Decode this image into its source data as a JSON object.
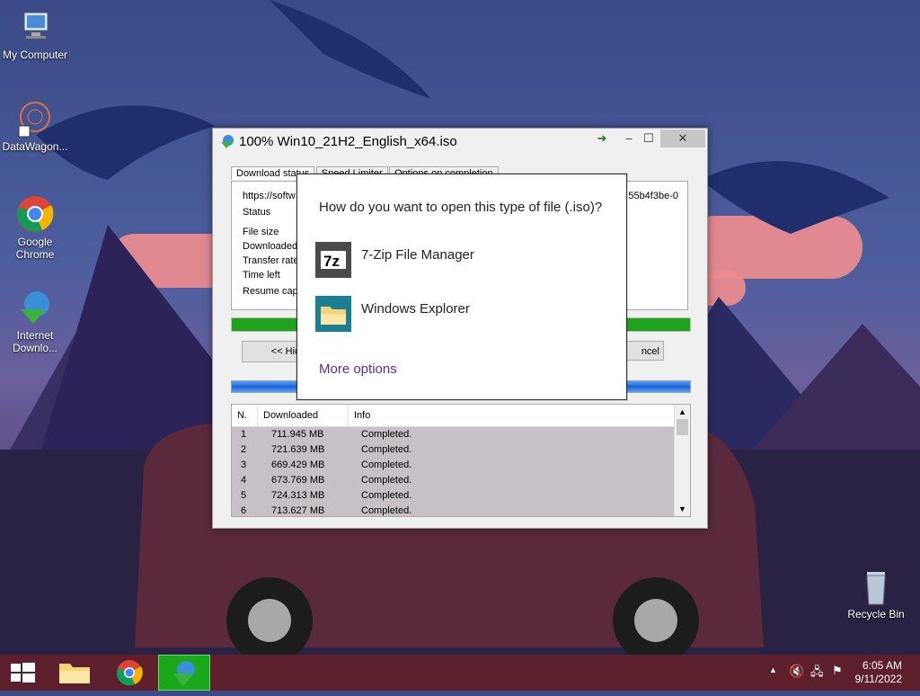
{
  "desktop": {
    "icons": [
      {
        "label": "My Computer"
      },
      {
        "label": "DataWagon..."
      },
      {
        "label": "Google Chrome"
      },
      {
        "label": "Internet Downlo..."
      },
      {
        "label": "Recycle Bin"
      }
    ]
  },
  "idm_window": {
    "title": "100% Win10_21H2_English_x64.iso",
    "tabs": [
      "Download status",
      "Speed Limiter",
      "Options on completion"
    ],
    "url_prefix": "https://softw",
    "url_suffix": "55b4f3be-0",
    "fields": [
      "Status",
      "File size",
      "Downloaded",
      "Transfer rate",
      "Time left",
      "Resume capa"
    ],
    "progress_percent": 100,
    "hide_button": "<< Hid",
    "cancel_button": "ncel",
    "table": {
      "columns": [
        "N.",
        "Downloaded",
        "Info"
      ],
      "rows": [
        {
          "n": "1",
          "downloaded": "711.945  MB",
          "info": "Completed."
        },
        {
          "n": "2",
          "downloaded": "721.639  MB",
          "info": "Completed."
        },
        {
          "n": "3",
          "downloaded": "669.429  MB",
          "info": "Completed."
        },
        {
          "n": "4",
          "downloaded": "673.769  MB",
          "info": "Completed."
        },
        {
          "n": "5",
          "downloaded": "724.313  MB",
          "info": "Completed."
        },
        {
          "n": "6",
          "downloaded": "713.627  MB",
          "info": "Completed."
        }
      ]
    }
  },
  "dialog": {
    "question": "How do you want to open this type of file (.iso)?",
    "options": [
      {
        "label": "7-Zip File Manager",
        "icon": "7zip-icon"
      },
      {
        "label": "Windows Explorer",
        "icon": "explorer-folder-icon"
      }
    ],
    "more_options": "More options"
  },
  "taskbar": {
    "clock_time": "6:05 AM",
    "clock_date": "9/11/2022"
  },
  "colors": {
    "taskbar": "#5c1f2b",
    "progress": "#1fa31f",
    "link": "#5b2aa0"
  }
}
